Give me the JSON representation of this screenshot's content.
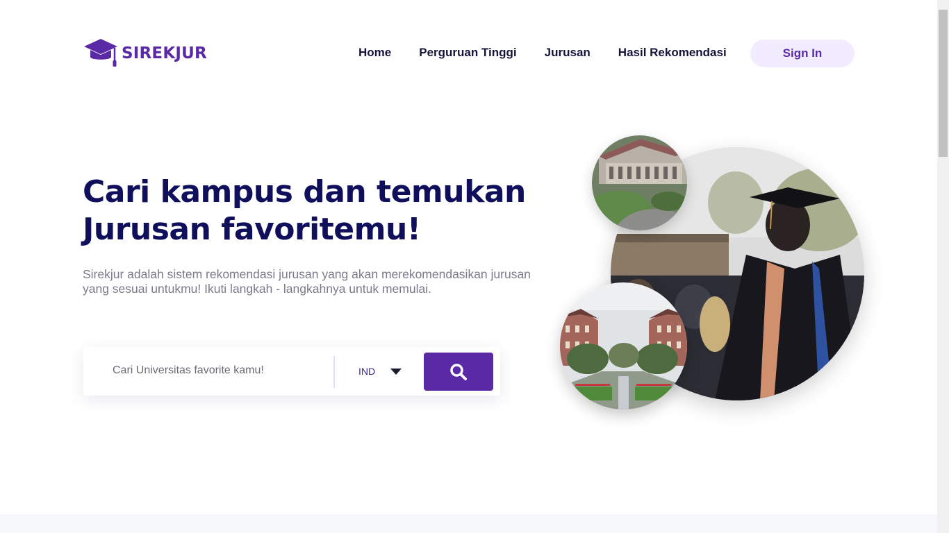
{
  "brand": {
    "name": "SIREKJUR",
    "logo_icon": "graduation-cap-icon",
    "color": "#5a2aa6"
  },
  "nav": {
    "items": [
      {
        "label": "Home"
      },
      {
        "label": "Perguruan Tinggi"
      },
      {
        "label": "Jurusan"
      },
      {
        "label": "Hasil Rekomendasi"
      }
    ],
    "signin_label": "Sign In"
  },
  "hero": {
    "title": "Cari kampus dan temukan Jurusan favoritemu!",
    "subtitle": "Sirekjur adalah sistem rekomendasi jurusan yang akan merekomendasikan jurusan yang sesuai untukmu! Ikuti langkah - langkahnya untuk memulai."
  },
  "search": {
    "placeholder": "Cari Universitas favorite kamu!",
    "language": "IND",
    "button_icon": "search-icon"
  },
  "colors": {
    "primary": "#5a2aa6",
    "heading": "#0f0f5c",
    "signin_bg": "#f1ecff"
  }
}
